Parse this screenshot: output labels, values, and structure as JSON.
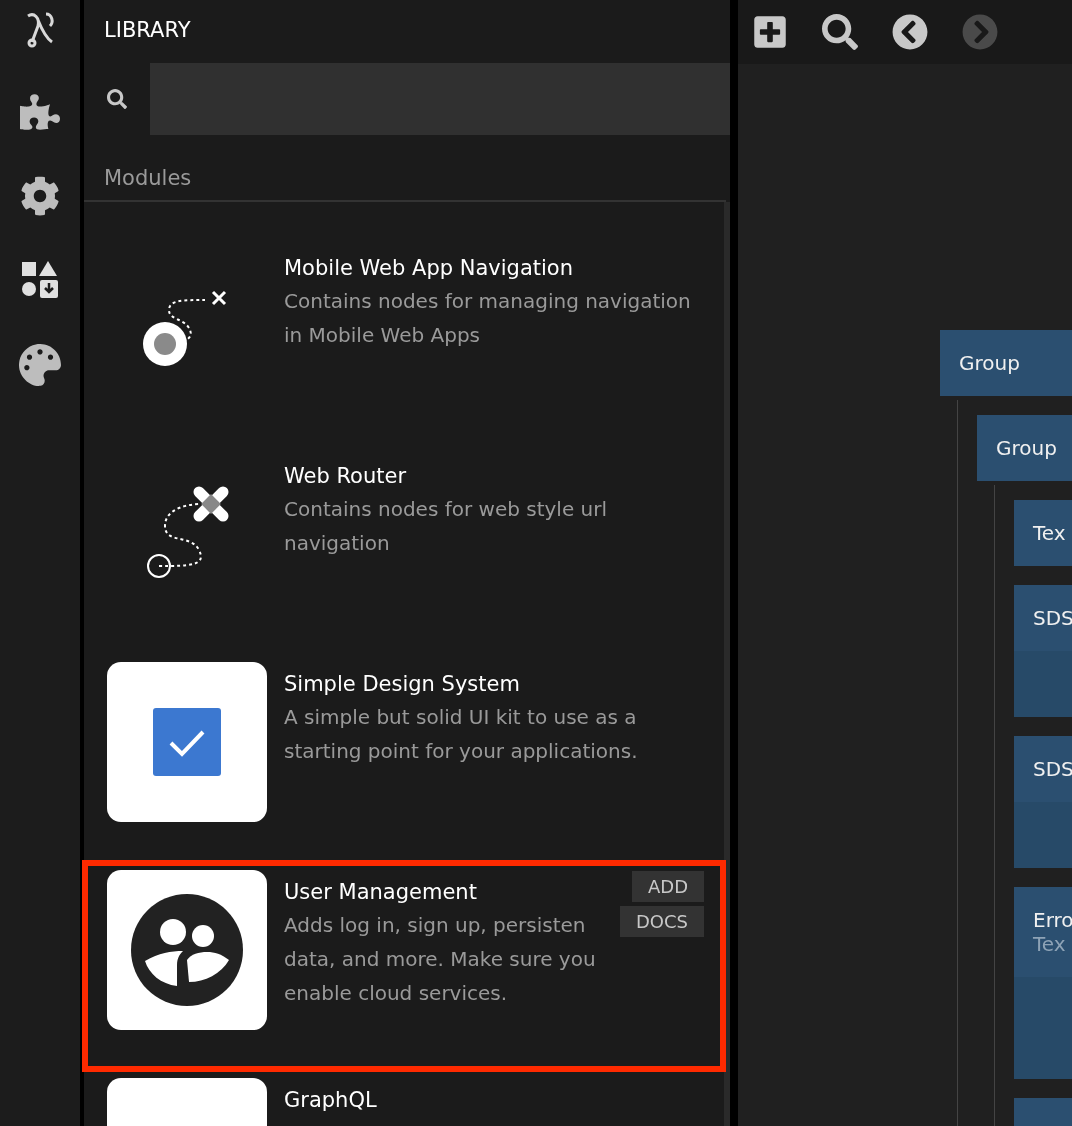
{
  "rail": {
    "items": [
      {
        "kind": "logo"
      },
      {
        "kind": "puzzle"
      },
      {
        "kind": "gear"
      },
      {
        "kind": "shapes"
      },
      {
        "kind": "palette"
      }
    ]
  },
  "library": {
    "title": "LIBRARY",
    "section": "Modules",
    "modules": [
      {
        "kind": "nav",
        "title": "Mobile Web App Navigation",
        "description": "Contains nodes for managing navigation in Mobile Web Apps",
        "highlighted": false
      },
      {
        "kind": "router",
        "title": "Web Router",
        "description": "Contains nodes for web style url navigation",
        "highlighted": false
      },
      {
        "kind": "checkbox",
        "title": "Simple Design System",
        "description": "A simple but solid UI kit to use as a starting point for your applications.",
        "highlighted": false
      },
      {
        "kind": "users",
        "title": "User Management",
        "description": "Adds log in, sign up, persisten data, and more. Make sure you enable cloud services.",
        "highlighted": true,
        "buttons": [
          "ADD",
          "DOCS"
        ]
      },
      {
        "kind": "graphql",
        "title": "GraphQL",
        "highlighted": false
      }
    ]
  },
  "toolbar": [
    {
      "kind": "add",
      "disabled": false
    },
    {
      "kind": "search",
      "disabled": false
    },
    {
      "kind": "back",
      "disabled": false
    },
    {
      "kind": "forward",
      "disabled": true
    }
  ],
  "canvas": {
    "nodes": [
      {
        "label": "Group",
        "children": [
          {
            "label": "Group",
            "children": [
              {
                "label": "Tex",
                "kind": "plain"
              },
              {
                "label": "SDS",
                "kind": "visual"
              },
              {
                "label": "SDS",
                "kind": "visual"
              },
              {
                "label": "Erro",
                "subtitle": "Tex",
                "kind": "visual"
              },
              {
                "kind": "plain"
              }
            ]
          }
        ]
      }
    ]
  }
}
